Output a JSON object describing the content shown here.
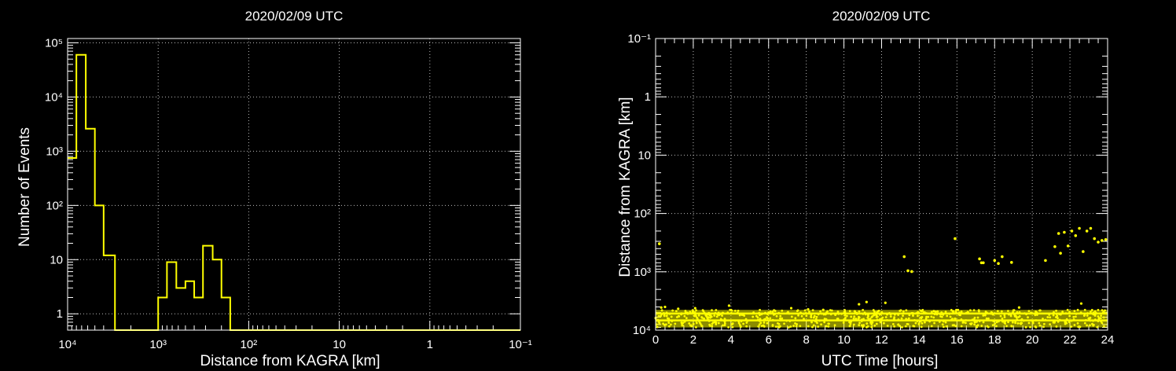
{
  "chart_data": [
    {
      "type": "histogram",
      "title": "2020/02/09 UTC",
      "xlabel": "Distance from KAGRA [km]",
      "ylabel": "Number of Events",
      "x_scale": "log",
      "x_reversed": true,
      "xlim": [
        10000,
        0.1
      ],
      "y_scale": "log",
      "ylim": [
        0.5,
        120000
      ],
      "x_ticks": [
        "10⁴",
        "10³",
        "10²",
        "10",
        "1",
        "10⁻¹"
      ],
      "y_ticks": [
        "1",
        "10",
        "10²",
        "10³",
        "10⁴",
        "10⁵"
      ],
      "grid": true,
      "color": "#ffff00",
      "bin_edges_km": [
        10000,
        8000,
        6300,
        5000,
        4000,
        3000,
        1000,
        800,
        630,
        500,
        400,
        320,
        250,
        200,
        160,
        0.1
      ],
      "counts": [
        750,
        60000,
        2600,
        100,
        12,
        0,
        2,
        9,
        3,
        4,
        2,
        18,
        10,
        2,
        0
      ]
    },
    {
      "type": "scatter",
      "title": "2020/02/09 UTC",
      "xlabel": "UTC Time [hours]",
      "ylabel": "Distance from KAGRA [km]",
      "xlim": [
        0,
        24
      ],
      "y_scale": "log",
      "y_reversed": true,
      "ylim": [
        0.1,
        10000
      ],
      "x_ticks": [
        "0",
        "2",
        "4",
        "6",
        "8",
        "10",
        "12",
        "14",
        "16",
        "18",
        "20",
        "22",
        "24"
      ],
      "y_ticks": [
        "10⁻¹",
        "1",
        "10",
        "10²",
        "10³",
        "10⁴"
      ],
      "grid": true,
      "color": "#ffff00",
      "points": [
        [
          0.2,
          330
        ],
        [
          13.2,
          550
        ],
        [
          13.4,
          960
        ],
        [
          13.6,
          990
        ],
        [
          15.9,
          270
        ],
        [
          17.2,
          600
        ],
        [
          17.3,
          700
        ],
        [
          17.4,
          700
        ],
        [
          18.0,
          640
        ],
        [
          18.2,
          720
        ],
        [
          18.4,
          550
        ],
        [
          18.9,
          690
        ],
        [
          20.7,
          640
        ],
        [
          21.2,
          370
        ],
        [
          21.4,
          220
        ],
        [
          21.5,
          480
        ],
        [
          21.7,
          210
        ],
        [
          21.9,
          360
        ],
        [
          22.1,
          200
        ],
        [
          22.3,
          240
        ],
        [
          22.5,
          180
        ],
        [
          22.7,
          450
        ],
        [
          22.9,
          200
        ],
        [
          23.1,
          180
        ],
        [
          23.3,
          270
        ],
        [
          23.5,
          310
        ],
        [
          23.7,
          290
        ],
        [
          23.9,
          280
        ]
      ],
      "band_points": [
        [
          0.3,
          4100
        ],
        [
          0.5,
          4000
        ],
        [
          1.2,
          4300
        ],
        [
          2.1,
          4200
        ],
        [
          3.9,
          3800
        ],
        [
          7.2,
          4200
        ],
        [
          8.1,
          4400
        ],
        [
          8.9,
          4500
        ],
        [
          10.8,
          3600
        ],
        [
          11.2,
          3300
        ],
        [
          12.2,
          3400
        ],
        [
          19.3,
          4100
        ],
        [
          22.6,
          3500
        ]
      ],
      "band": {
        "x_range": [
          0,
          24
        ],
        "y_range_km": [
          4500,
          9000
        ],
        "levels_km": [
          6800,
          5200
        ]
      }
    }
  ]
}
